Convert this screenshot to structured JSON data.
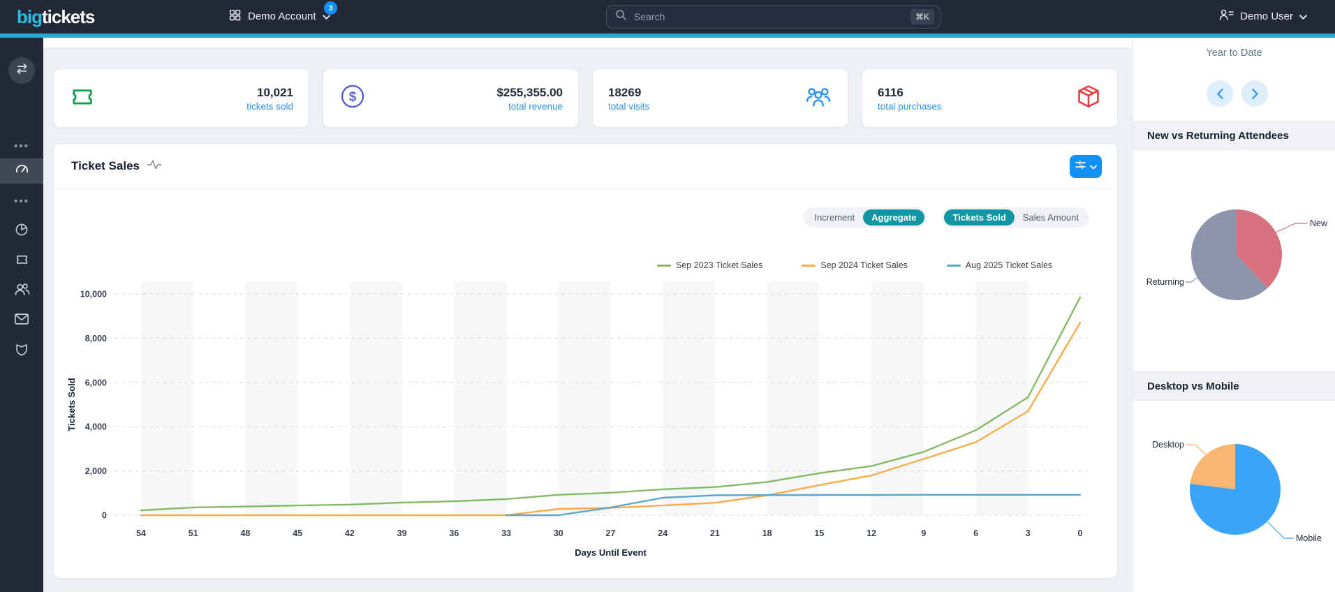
{
  "colors": {
    "accent_bar": "#14b1d2",
    "primary_blue": "#1191f5",
    "toggle_active_teal": "#1396a3",
    "link_blue": "#2b96f2"
  },
  "nav": {
    "logo_big": "big",
    "logo_rest": "tickets",
    "account_label": "Demo Account",
    "account_badge": "3",
    "search_placeholder": "Search",
    "search_shortcut": "⌘K",
    "user_label": "Demo User"
  },
  "sidebar": {
    "items": [
      "swap-horizontal",
      "ellipsis",
      "dashboard (active)",
      "ellipsis",
      "pie-chart",
      "ticket",
      "users",
      "mail",
      "shield"
    ]
  },
  "stats": [
    {
      "value": "10,021",
      "label": "tickets sold",
      "icon": "ticket-icon",
      "icon_color": "#0ea24e"
    },
    {
      "value": "$255,355.00",
      "label": "total revenue",
      "icon": "dollar-circle-icon",
      "icon_color": "#5a62c6"
    },
    {
      "value": "18269",
      "label": "total visits",
      "icon": "users-group-icon",
      "icon_color": "#2b96f2"
    },
    {
      "value": "6116",
      "label": "total purchases",
      "icon": "package-icon",
      "icon_color": "#e73b40"
    }
  ],
  "panel": {
    "title": "Ticket Sales",
    "toggles": {
      "mode": {
        "options": [
          "Increment",
          "Aggregate"
        ],
        "active": "Aggregate"
      },
      "metric": {
        "options": [
          "Tickets Sold",
          "Sales Amount"
        ],
        "active": "Tickets Sold"
      }
    }
  },
  "chart_data": [
    {
      "type": "line",
      "title": "Ticket Sales",
      "x": [
        54,
        51,
        48,
        45,
        42,
        39,
        36,
        33,
        30,
        27,
        24,
        21,
        18,
        15,
        12,
        9,
        6,
        3,
        0
      ],
      "xlabel": "Days Until Event",
      "ylabel": "Tickets Sold",
      "ylim": [
        0,
        10000
      ],
      "yticks": [
        0,
        2000,
        4000,
        6000,
        8000,
        10000
      ],
      "grid": "horizontal-dashed with alternating vertical bands",
      "legend_position": "top-center",
      "series": [
        {
          "name": "Sep 2023 Ticket Sales",
          "color": "#85b964",
          "values": [
            220,
            350,
            390,
            440,
            480,
            570,
            630,
            730,
            920,
            1015,
            1170,
            1270,
            1500,
            1900,
            2220,
            2860,
            3840,
            5330,
            9850
          ]
        },
        {
          "name": "Sep 2024 Ticket Sales",
          "color": "#f8ac4a",
          "values": [
            0,
            0,
            0,
            0,
            0,
            0,
            0,
            0,
            285,
            330,
            440,
            560,
            900,
            1360,
            1800,
            2540,
            3300,
            4700,
            8700
          ]
        },
        {
          "name": "Aug 2025 Ticket Sales",
          "color": "#5ba6c9",
          "values": [
            null,
            null,
            null,
            null,
            null,
            null,
            null,
            0,
            0,
            350,
            790,
            900,
            910,
            915,
            915,
            920,
            920,
            920,
            920
          ]
        }
      ]
    },
    {
      "type": "pie",
      "title": "New vs Returning Attendees",
      "labels": [
        "New",
        "Returning"
      ],
      "values": [
        38,
        62
      ],
      "colors": [
        "#d7717e",
        "#8d94ab"
      ]
    },
    {
      "type": "pie",
      "title": "Desktop vs Mobile",
      "labels": [
        "Desktop",
        "Mobile"
      ],
      "values": [
        23,
        77
      ],
      "colors": [
        "#f9b571",
        "#3ba4f6"
      ]
    }
  ],
  "right": {
    "period_label": "Year to Date"
  }
}
